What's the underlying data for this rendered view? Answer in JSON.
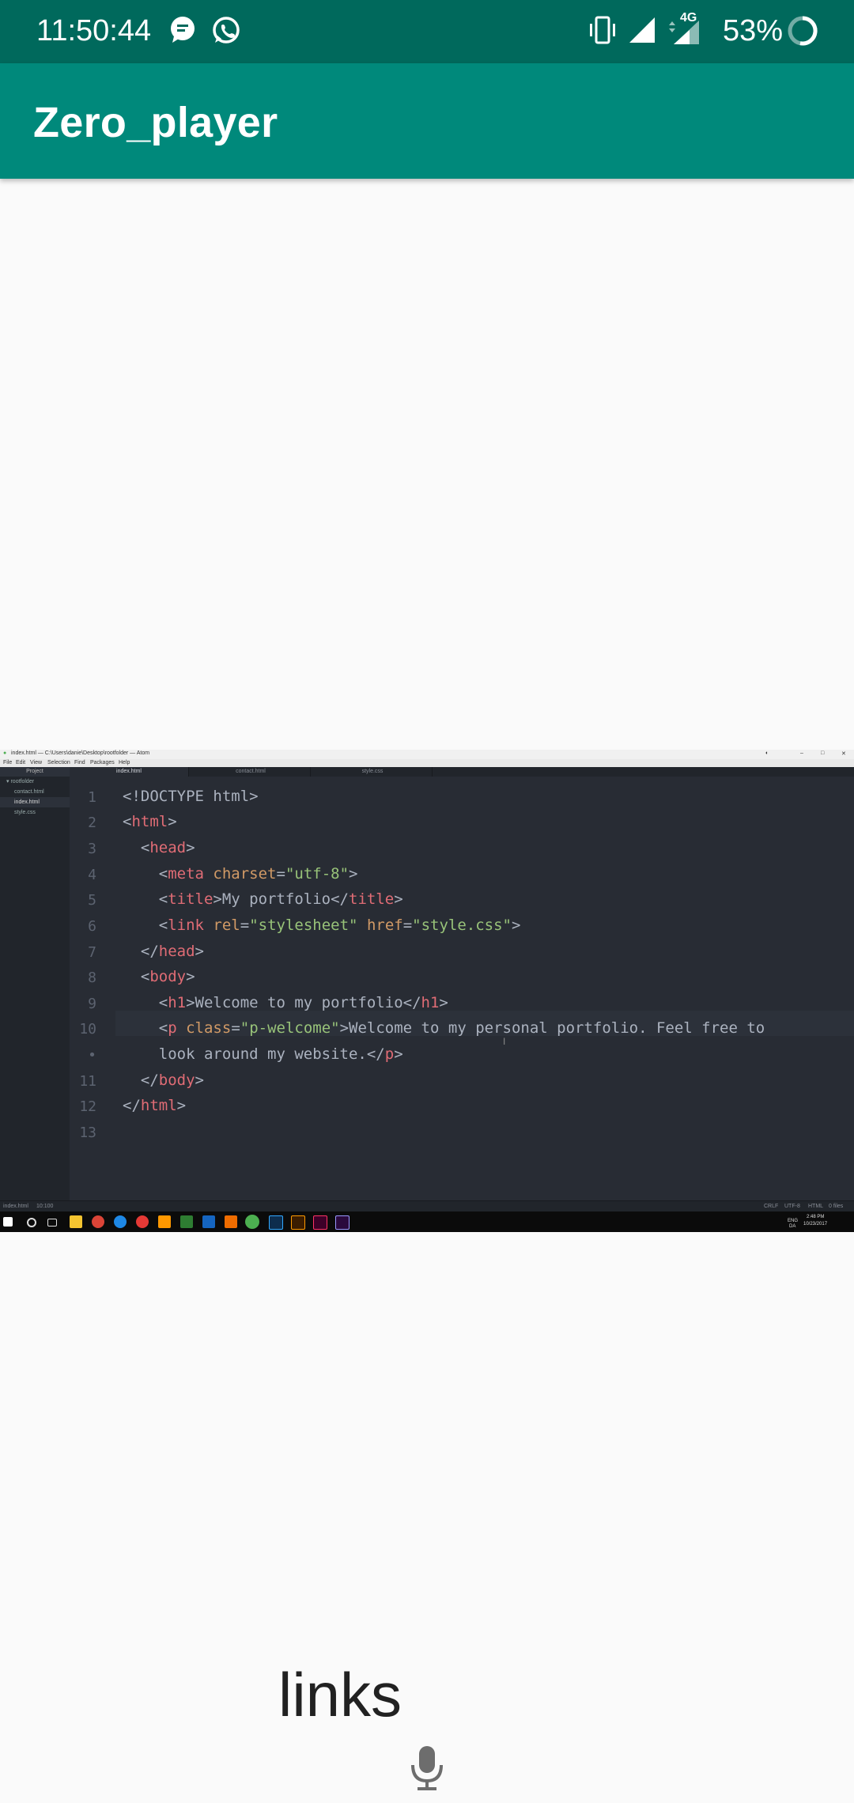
{
  "status_bar": {
    "time": "11:50:44",
    "battery": "53%",
    "network": "4G",
    "icons": [
      "message-icon",
      "whatsapp-icon",
      "vibrate-icon",
      "signal-icon",
      "signal-4g-icon",
      "battery-icon"
    ]
  },
  "app_bar": {
    "title": "Zero_player"
  },
  "video": {
    "window_title": "index.html — C:\\Users\\danie\\Desktop\\rootfolder — Atom",
    "menu": [
      "File",
      "Edit",
      "View",
      "Selection",
      "Find",
      "Packages",
      "Help"
    ],
    "tree": {
      "header": "Project",
      "root": "rootfolder",
      "files": [
        "contact.html",
        "index.html",
        "style.css"
      ],
      "selected": "index.html"
    },
    "tabs": [
      "index.html",
      "contact.html",
      "style.css"
    ],
    "line_numbers": [
      "1",
      "2",
      "3",
      "4",
      "5",
      "6",
      "7",
      "8",
      "9",
      "10",
      "•",
      "11",
      "12",
      "13"
    ],
    "status_left": [
      "index.html",
      "10:100"
    ],
    "status_right": [
      "CRLF",
      "UTF-8",
      "HTML",
      "0 files"
    ],
    "taskbar_clock": {
      "time": "2:48 PM",
      "date": "10/23/2017",
      "lang": "ENG",
      "region": "DA"
    }
  },
  "caption": "links",
  "mic_icon": "microphone-icon"
}
